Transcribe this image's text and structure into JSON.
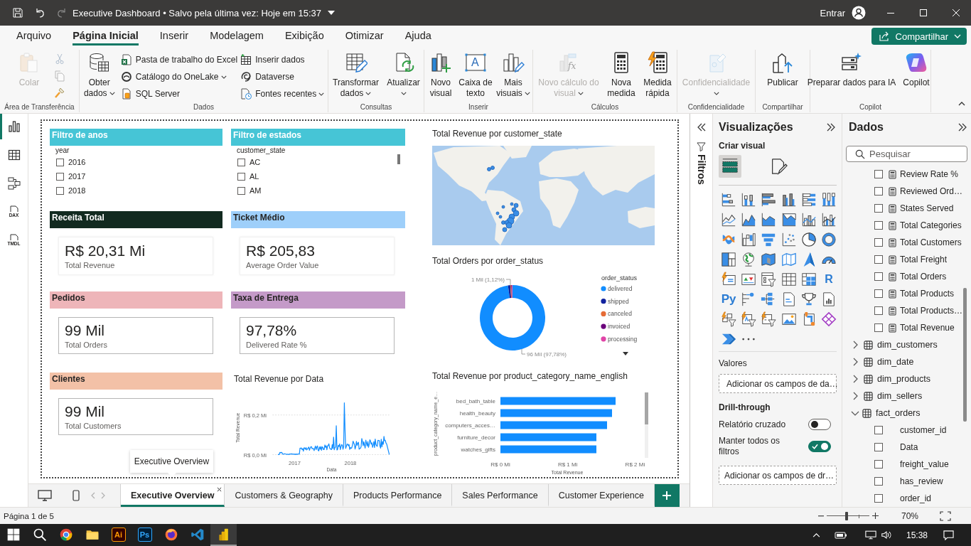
{
  "title_bar": {
    "title": "Executive Dashboard • Salvo pela última vez: Hoje em 15:37",
    "sign_in": "Entrar"
  },
  "ribbon_tabs": [
    {
      "label": "Arquivo",
      "selected": false
    },
    {
      "label": "Página Inicial",
      "selected": true
    },
    {
      "label": "Inserir",
      "selected": false
    },
    {
      "label": "Modelagem",
      "selected": false
    },
    {
      "label": "Exibição",
      "selected": false
    },
    {
      "label": "Otimizar",
      "selected": false
    },
    {
      "label": "Ajuda",
      "selected": false
    }
  ],
  "share_button": {
    "label": "Compartilhar"
  },
  "ribbon_groups": [
    {
      "label": "Área de Transferência",
      "large": [
        {
          "kind": "paste",
          "label": "Colar",
          "dropdown": false,
          "disabled": true
        }
      ],
      "tools": [
        {
          "kind": "cut",
          "disabled": true
        },
        {
          "kind": "copy",
          "disabled": true
        },
        {
          "kind": "format-painter",
          "disabled": false
        }
      ]
    },
    {
      "label": "Dados",
      "large": [
        {
          "kind": "get-data",
          "label": "Obter dados",
          "dropdown": true,
          "disabled": false
        }
      ],
      "small": [
        {
          "kind": "excel",
          "label": "Pasta de trabalho do Excel",
          "dropdown": false
        },
        {
          "kind": "onelake",
          "label": "Catálogo do OneLake",
          "dropdown": true
        },
        {
          "kind": "sql",
          "label": "SQL Server",
          "dropdown": false
        },
        {
          "kind": "enter-data",
          "label": "Inserir dados",
          "dropdown": false
        },
        {
          "kind": "dataverse",
          "label": "Dataverse",
          "dropdown": false
        },
        {
          "kind": "recent",
          "label": "Fontes recentes",
          "dropdown": true
        }
      ]
    },
    {
      "label": "Consultas",
      "large": [
        {
          "kind": "transform",
          "label": "Transformar dados",
          "dropdown": true,
          "disabled": false
        },
        {
          "kind": "refresh",
          "label": "Atualizar",
          "dropdown": true,
          "disabled": false
        }
      ]
    },
    {
      "label": "Inserir",
      "large": [
        {
          "kind": "new-visual",
          "label": "Novo visual",
          "dropdown": false,
          "disabled": false
        },
        {
          "kind": "text-box",
          "label": "Caixa de texto",
          "glyph": "A",
          "dropdown": false,
          "disabled": false
        },
        {
          "kind": "more-visuals",
          "label": "Mais visuais",
          "dropdown": true,
          "disabled": false
        }
      ]
    },
    {
      "label": "Cálculos",
      "large": [
        {
          "kind": "visual-calc",
          "label": "Novo cálculo do visual",
          "glyph": "fx",
          "dropdown": true,
          "disabled": true
        },
        {
          "kind": "new-measure",
          "label": "Nova medida",
          "dropdown": false,
          "disabled": false
        },
        {
          "kind": "quick-measure",
          "label": "Medida rápida",
          "dropdown": false,
          "disabled": false
        }
      ]
    },
    {
      "label": "Confidencialidade",
      "large": [
        {
          "kind": "sensitivity",
          "label": "Confidencialidade",
          "dropdown": true,
          "disabled": true
        }
      ]
    },
    {
      "label": "Compartilhar",
      "large": [
        {
          "kind": "publish",
          "label": "Publicar",
          "dropdown": false,
          "disabled": false
        }
      ]
    },
    {
      "label": "Copilot",
      "large": [
        {
          "kind": "prepare-ai",
          "label": "Preparar dados para IA",
          "dropdown": false,
          "disabled": false
        },
        {
          "kind": "copilot",
          "label": "Copilot",
          "dropdown": false,
          "disabled": false
        }
      ]
    }
  ],
  "views": [
    {
      "kind": "report",
      "selected": true
    },
    {
      "kind": "table",
      "selected": false
    },
    {
      "kind": "model",
      "selected": false
    },
    {
      "kind": "dax",
      "label": "DAX",
      "selected": false
    },
    {
      "kind": "tmdl",
      "label": "TMDL",
      "selected": false
    }
  ],
  "canvas": {
    "slicers": [
      {
        "header": "Filtro de anos",
        "color": "#46c5d6",
        "field": "year",
        "scrollable": false,
        "items": [
          {
            "label": "2016",
            "checked": false
          },
          {
            "label": "2017",
            "checked": false
          },
          {
            "label": "2018",
            "checked": false
          }
        ]
      },
      {
        "header": "Filtro de estados",
        "color": "#46c5d6",
        "field": "customer_state",
        "scrollable": true,
        "items": [
          {
            "label": "AC",
            "checked": false
          },
          {
            "label": "AL",
            "checked": false
          },
          {
            "label": "AM",
            "checked": false
          }
        ]
      }
    ],
    "cards": [
      {
        "header": "Receita Total",
        "color": "#122a20",
        "kind": "shadow",
        "value": "R$ 20,31 Mi",
        "caption": "Total Revenue"
      },
      {
        "header": "Ticket Médio",
        "color": "#9ecffa",
        "kind": "shadow",
        "value": "R$ 205,83",
        "caption": "Average Order Value"
      },
      {
        "header": "Pedidos",
        "color": "#eeb5b9",
        "kind": "outlined",
        "value": "99 Mil",
        "caption": "Total Orders"
      },
      {
        "header": "Taxa de Entrega",
        "color": "#c49ac8",
        "kind": "outlined",
        "value": "97,78%",
        "caption": "Delivered Rate %"
      },
      {
        "header": "Clientes",
        "color": "#f3c1a7",
        "kind": "outlined",
        "value": "99 Mil",
        "caption": "Total Customers"
      }
    ],
    "line_chart": {
      "title": "Total Revenue por Data",
      "ylabel": "Total Revenue",
      "xlabel": "Data",
      "y_tick_labels": [
        "R$ 0,2 Mi",
        "R$ 0,0 Mi"
      ],
      "x_tick_labels": [
        "2017",
        "2018"
      ]
    },
    "map": {
      "title": "Total Revenue por customer_state"
    },
    "donut": {
      "title": "Total Orders por order_status",
      "legend_title": "order_status",
      "legend": [
        {
          "label": "delivered",
          "color": "#118dff"
        },
        {
          "label": "shipped",
          "color": "#12239e"
        },
        {
          "label": "canceled",
          "color": "#e66c37"
        },
        {
          "label": "invoiced",
          "color": "#6b007b"
        },
        {
          "label": "processing",
          "color": "#e044a7"
        }
      ],
      "data_labels": [
        "1 Mil (1,12%)",
        "96 Mil (97,78%)"
      ]
    },
    "bar_chart": {
      "title": "Total Revenue por product_category_name_english",
      "ylabel": "product_category_name_e…",
      "xlabel": "Total Revenue",
      "categories": [
        "bed_bath_table",
        "health_beauty",
        "computers_acces…",
        "furniture_decor",
        "watches_gifts"
      ],
      "x_tick_labels": [
        "R$ 0 Mi",
        "R$ 1 Mi",
        "R$ 2 Mi"
      ]
    },
    "tooltip": "Executive Overview"
  },
  "page_tabs": [
    {
      "label": "Executive Overview",
      "selected": true
    },
    {
      "label": "Customers & Geography",
      "selected": false
    },
    {
      "label": "Products Performance",
      "selected": false
    },
    {
      "label": "Sales Performance",
      "selected": false
    },
    {
      "label": "Customer Experience",
      "selected": false
    }
  ],
  "filters_pane": {
    "label": "Filtros"
  },
  "visualizations": {
    "title": "Visualizações",
    "subtitle": "Criar visual",
    "modes": [
      {
        "kind": "build",
        "selected": true
      },
      {
        "kind": "format",
        "selected": false
      }
    ],
    "gallery": [
      {
        "kind": "stacked-bar"
      },
      {
        "kind": "stacked-column"
      },
      {
        "kind": "clustered-bar"
      },
      {
        "kind": "clustered-column"
      },
      {
        "kind": "full-bar"
      },
      {
        "kind": "full-column"
      },
      {
        "kind": "line"
      },
      {
        "kind": "area"
      },
      {
        "kind": "stacked-area"
      },
      {
        "kind": "full-area"
      },
      {
        "kind": "line-stacked-column"
      },
      {
        "kind": "line-clustered-column"
      },
      {
        "kind": "ribbon"
      },
      {
        "kind": "waterfall"
      },
      {
        "kind": "funnel"
      },
      {
        "kind": "scatter"
      },
      {
        "kind": "pie"
      },
      {
        "kind": "donut"
      },
      {
        "kind": "treemap"
      },
      {
        "kind": "globe"
      },
      {
        "kind": "filled-map"
      },
      {
        "kind": "shape-map"
      },
      {
        "kind": "azure-map"
      },
      {
        "kind": "gauge"
      },
      {
        "kind": "card"
      },
      {
        "kind": "kpi"
      },
      {
        "kind": "slicer"
      },
      {
        "kind": "table"
      },
      {
        "kind": "matrix"
      },
      {
        "kind": "r",
        "label": "R"
      },
      {
        "kind": "python",
        "label": "Py"
      },
      {
        "kind": "key-influencers"
      },
      {
        "kind": "decomposition"
      },
      {
        "kind": "narrative"
      },
      {
        "kind": "metrics"
      },
      {
        "kind": "paginated"
      },
      {
        "kind": "button-slicer"
      },
      {
        "kind": "text-slicer"
      },
      {
        "kind": "list-slicer"
      },
      {
        "kind": "image"
      },
      {
        "kind": "arcgis"
      },
      {
        "kind": "power-apps"
      },
      {
        "kind": "power-automate"
      },
      {
        "kind": "more"
      }
    ],
    "values_well": {
      "label": "Valores",
      "placeholder": "Adicionar os campos de da…"
    },
    "drill_through": {
      "label": "Drill-through",
      "toggles": [
        {
          "label": "Relatório cruzado",
          "on": false
        },
        {
          "label": "Manter todos os filtros",
          "on": true
        }
      ],
      "placeholder": "Adicionar os campos de dr…"
    }
  },
  "data": {
    "title": "Dados",
    "search": {
      "placeholder": "Pesquisar"
    },
    "tree": [
      {
        "children": [
          {
            "kind": "measure",
            "name": "Review Rate %",
            "checked": false
          },
          {
            "kind": "measure",
            "name": "Reviewed Ord…",
            "checked": false
          },
          {
            "kind": "measure",
            "name": "States Served",
            "checked": false
          },
          {
            "kind": "measure",
            "name": "Total Categories",
            "checked": false
          },
          {
            "kind": "measure",
            "name": "Total Customers",
            "checked": false
          },
          {
            "kind": "measure",
            "name": "Total Freight",
            "checked": false
          },
          {
            "kind": "measure",
            "name": "Total Orders",
            "checked": false
          },
          {
            "kind": "measure",
            "name": "Total Products",
            "checked": false
          },
          {
            "kind": "measure",
            "name": "Total Products…",
            "checked": false
          },
          {
            "kind": "measure",
            "name": "Total Revenue",
            "checked": false
          }
        ]
      },
      {
        "name": "dim_customers",
        "expanded": false
      },
      {
        "name": "dim_date",
        "expanded": false
      },
      {
        "name": "dim_products",
        "expanded": false
      },
      {
        "name": "dim_sellers",
        "expanded": false
      },
      {
        "name": "fact_orders",
        "expanded": true,
        "children": [
          {
            "kind": "column",
            "name": "customer_id",
            "checked": false
          },
          {
            "kind": "column",
            "name": "Data",
            "checked": false
          },
          {
            "kind": "column",
            "name": "freight_value",
            "checked": false
          },
          {
            "kind": "column",
            "name": "has_review",
            "checked": false
          },
          {
            "kind": "column",
            "name": "order_id",
            "checked": false
          }
        ]
      }
    ]
  },
  "status_bar": {
    "page": "Página 1 de 5",
    "zoom": {
      "level": 0.47,
      "label": "70%"
    }
  },
  "taskbar": {
    "apps": [
      {
        "kind": "start",
        "selected": false
      },
      {
        "kind": "search",
        "selected": false
      },
      {
        "kind": "chrome",
        "selected": false
      },
      {
        "kind": "explorer",
        "selected": false
      },
      {
        "kind": "illustrator",
        "label": "Ai",
        "selected": false
      },
      {
        "kind": "photoshop",
        "label": "Ps",
        "selected": false
      },
      {
        "kind": "firefox",
        "selected": false
      },
      {
        "kind": "vscode",
        "selected": false
      },
      {
        "kind": "powerbi",
        "selected": true
      }
    ],
    "clock": "15:38"
  }
}
